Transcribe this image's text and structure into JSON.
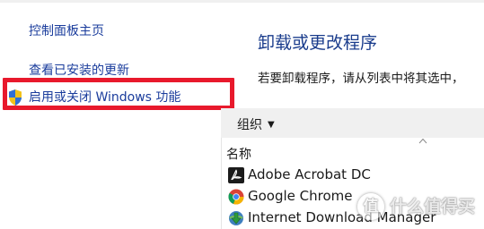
{
  "sidebar": {
    "home_label": "控制面板主页",
    "updates_label": "查看已安装的更新",
    "features_label": "启用或关闭 Windows 功能"
  },
  "main": {
    "title": "卸载或更改程序",
    "description": "若要卸载程序，请从列表中将其选中，"
  },
  "toolbar": {
    "organize_label": "组织",
    "organize_caret": "▼"
  },
  "table": {
    "name_column": "名称"
  },
  "programs": [
    {
      "name": "Adobe Acrobat DC",
      "icon": "adobe-acrobat-icon"
    },
    {
      "name": "Google Chrome",
      "icon": "chrome-icon"
    },
    {
      "name": "Internet Download Manager",
      "icon": "idm-icon"
    }
  ],
  "watermark": {
    "badge": "值",
    "text": "什么值得买"
  },
  "colors": {
    "link": "#1a3c9c",
    "highlight": "#e8192c",
    "toolbar_bg": "#f0f0f0"
  }
}
